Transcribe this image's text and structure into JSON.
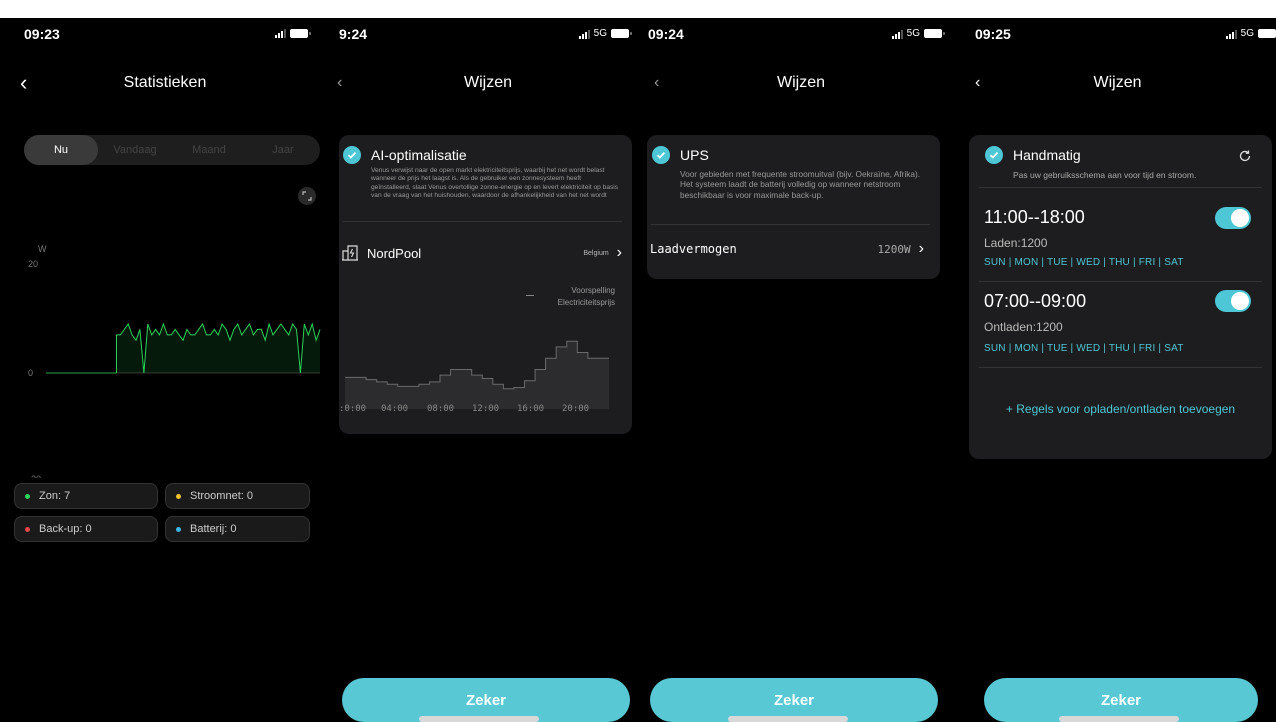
{
  "colors": {
    "accent": "#4dc7d6",
    "button": "#57c8d4",
    "card": "#1d1d1f",
    "solar": "#2bd35a",
    "grid": "#f2c230",
    "backup": "#e84545",
    "battery": "#3ab6e3"
  },
  "screen1": {
    "time": "09:23",
    "title": "Statistieken",
    "tabs": [
      "Nu",
      "Vandaag",
      "Maand",
      "Jaar"
    ],
    "selected_tab": "Nu",
    "legend": [
      {
        "label": "Zon: 7",
        "color": "#2bd35a"
      },
      {
        "label": "Stroomnet: 0",
        "color": "#f2c230"
      },
      {
        "label": "Back-up: 0",
        "color": "#e84545"
      },
      {
        "label": "Batterij: 0",
        "color": "#3ab6e3"
      }
    ],
    "chart_data": {
      "type": "line",
      "ylabel": "W",
      "ylim": [
        -20,
        20
      ],
      "yticks": [
        20,
        0,
        -20
      ],
      "series": [
        {
          "name": "Zon",
          "color": "#2bd35a",
          "values": [
            0,
            0,
            0,
            0,
            0,
            0,
            0,
            0,
            0,
            0,
            0,
            0,
            0,
            0,
            0,
            0,
            0,
            0,
            7,
            7,
            8,
            9,
            7,
            6,
            8,
            0,
            9,
            7,
            8,
            7,
            9,
            7,
            7,
            8,
            7,
            6,
            8,
            7,
            7,
            8,
            9,
            7,
            7,
            8,
            7,
            9,
            8,
            6,
            8,
            9,
            7,
            8,
            9,
            7,
            8,
            8,
            6,
            9,
            7,
            8,
            9,
            8,
            7,
            9,
            8,
            0,
            9,
            7,
            9,
            6,
            8
          ]
        }
      ]
    }
  },
  "screen2": {
    "time": "9:24",
    "network": "5G",
    "title": "Wijzen",
    "ai_title": "AI-optimalisatie",
    "ai_desc": "Venus verwijst naar de open markt elektriciteitsprijs, waarbij het net wordt belast wanneer de prijs het laagst is. Als de gebruiker een zonnesysteem heeft geïnstalleerd, slaat Venus overtollige zonne-energie op en levert elektriciteit op basis van de vraag van het huishouden, waardoor de afhankelijkheid van het net wordt",
    "nordpool_label": "NordPool",
    "nordpool_region": "Belgium",
    "legend_line1": "Voorspelling",
    "legend_line2": "Electriciteitsprijs",
    "xticks": [
      ":0:00",
      "04:00",
      "08:00",
      "12:00",
      "16:00",
      "20:00"
    ],
    "button": "Zeker",
    "chart_data": {
      "type": "area",
      "series": [
        {
          "name": "Voorspelling Electriciteitsprijs",
          "values": [
            0.28,
            0.28,
            0.26,
            0.24,
            0.22,
            0.2,
            0.2,
            0.22,
            0.24,
            0.3,
            0.35,
            0.35,
            0.3,
            0.27,
            0.22,
            0.18,
            0.19,
            0.25,
            0.35,
            0.45,
            0.55,
            0.6,
            0.5,
            0.45,
            0.45
          ]
        }
      ]
    }
  },
  "screen3": {
    "time": "09:24",
    "network": "5G",
    "title": "Wijzen",
    "ups_title": "UPS",
    "ups_desc": "Voor gebieden met frequente stroomuitval (bijv. Oekraïne, Afrika). Het systeem laadt de batterij volledig op wanneer netstroom beschikbaar is voor maximale back-up.",
    "charge_label": "Laadvermogen",
    "charge_value": "1200W",
    "button": "Zeker"
  },
  "screen4": {
    "time": "09:25",
    "network": "5G",
    "title": "Wijzen",
    "manual_title": "Handmatig",
    "manual_desc": "Pas uw gebruiksschema aan voor tijd en stroom.",
    "rules": [
      {
        "time": "11:00--18:00",
        "mode": "Laden:1200",
        "days": "SUN | MON | TUE | WED | THU | FRI | SAT",
        "enabled": true
      },
      {
        "time": "07:00--09:00",
        "mode": "Ontladen:1200",
        "days": "SUN | MON | TUE | WED | THU | FRI | SAT",
        "enabled": true
      }
    ],
    "add_rule": "+ Regels voor opladen/ontladen toevoegen",
    "button": "Zeker"
  }
}
